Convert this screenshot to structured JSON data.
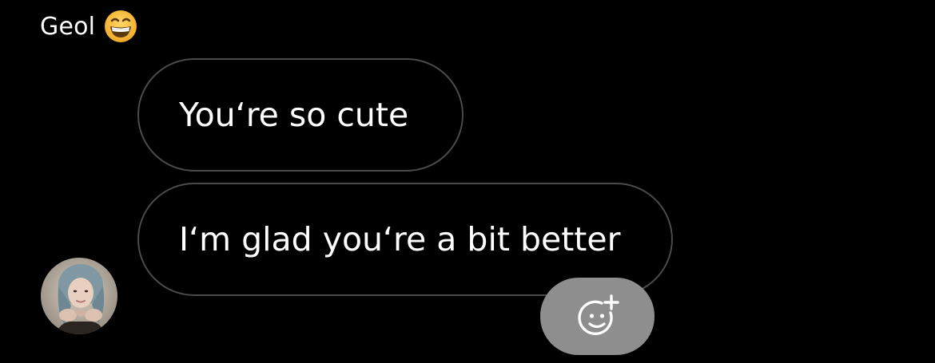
{
  "conversation": {
    "sender": {
      "name": "Geol",
      "name_emoji_icon": "grinning-face-emoji-icon"
    },
    "messages": [
      {
        "text": "You‘re so cute"
      },
      {
        "text": "I‘m glad you‘re a bit better"
      }
    ],
    "avatar_icon": "profile-photo",
    "reaction_button_icon": "add-reaction-smiley-icon"
  },
  "colors": {
    "background": "#000000",
    "bubble_border": "#4a4a4a",
    "text": "#ffffff",
    "reaction_button_bg": "#8e8e8e",
    "emoji_yellow": "#f7c23a"
  }
}
